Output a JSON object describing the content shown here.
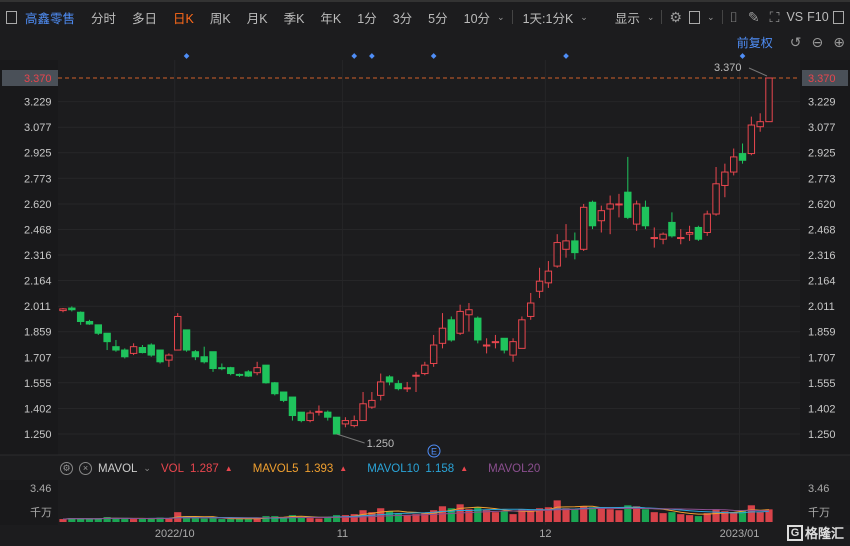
{
  "toolbar": {
    "stock_name": "高鑫零售",
    "periods": [
      "分时",
      "多日",
      "日K",
      "周K",
      "月K",
      "季K",
      "年K",
      "1分",
      "3分",
      "5分",
      "10分"
    ],
    "active_period": "日K",
    "multi_period": "1天:1分K",
    "display": "显示",
    "vs": "VS",
    "f10": "F10",
    "adjust": "前复权",
    "icons": [
      "sidebar-toggle-icon",
      "chevron-down-icon",
      "settings-icon",
      "layout-icon",
      "camera-icon",
      "pencil-icon",
      "fullscreen-icon",
      "undo-icon",
      "zoom-out-icon",
      "zoom-in-icon"
    ]
  },
  "chart_data": {
    "type": "candlestick",
    "y_ticks": [
      "3.370",
      "3.229",
      "3.077",
      "2.925",
      "2.773",
      "2.620",
      "2.468",
      "2.316",
      "2.164",
      "2.011",
      "1.859",
      "1.707",
      "1.555",
      "1.402",
      "1.250"
    ],
    "ylim": [
      1.25,
      3.37
    ],
    "x_labels": [
      {
        "label": "2022/10",
        "index": 13
      },
      {
        "label": "11",
        "index": 32
      },
      {
        "label": "12",
        "index": 55
      },
      {
        "label": "2023/01",
        "index": 77
      }
    ],
    "high_label": "3.370",
    "low_label": "1.250",
    "event_marker": "E",
    "event_diamond_indices": [
      14,
      33,
      35,
      42,
      57,
      77
    ],
    "ohlc": [
      [
        1.985,
        1.995,
        2.0,
        1.975
      ],
      [
        2.0,
        1.99,
        2.01,
        1.98
      ],
      [
        1.975,
        1.92,
        1.98,
        1.9
      ],
      [
        1.92,
        1.905,
        1.93,
        1.9
      ],
      [
        1.9,
        1.85,
        1.9,
        1.84
      ],
      [
        1.85,
        1.8,
        1.85,
        1.75
      ],
      [
        1.77,
        1.75,
        1.81,
        1.74
      ],
      [
        1.75,
        1.71,
        1.76,
        1.7
      ],
      [
        1.73,
        1.77,
        1.79,
        1.72
      ],
      [
        1.765,
        1.735,
        1.78,
        1.73
      ],
      [
        1.78,
        1.72,
        1.79,
        1.71
      ],
      [
        1.75,
        1.68,
        1.75,
        1.67
      ],
      [
        1.69,
        1.72,
        1.73,
        1.65
      ],
      [
        1.75,
        1.95,
        1.97,
        1.75
      ],
      [
        1.87,
        1.75,
        1.87,
        1.74
      ],
      [
        1.74,
        1.71,
        1.75,
        1.69
      ],
      [
        1.71,
        1.68,
        1.77,
        1.67
      ],
      [
        1.74,
        1.64,
        1.74,
        1.62
      ],
      [
        1.645,
        1.64,
        1.67,
        1.63
      ],
      [
        1.645,
        1.61,
        1.65,
        1.6
      ],
      [
        1.605,
        1.6,
        1.61,
        1.59
      ],
      [
        1.62,
        1.595,
        1.63,
        1.59
      ],
      [
        1.615,
        1.645,
        1.68,
        1.6
      ],
      [
        1.66,
        1.555,
        1.66,
        1.55
      ],
      [
        1.555,
        1.49,
        1.56,
        1.48
      ],
      [
        1.5,
        1.45,
        1.5,
        1.44
      ],
      [
        1.47,
        1.36,
        1.47,
        1.33
      ],
      [
        1.38,
        1.33,
        1.38,
        1.32
      ],
      [
        1.33,
        1.375,
        1.39,
        1.32
      ],
      [
        1.38,
        1.385,
        1.42,
        1.36
      ],
      [
        1.38,
        1.35,
        1.39,
        1.33
      ],
      [
        1.35,
        1.25,
        1.35,
        1.25
      ],
      [
        1.31,
        1.33,
        1.35,
        1.29
      ],
      [
        1.3,
        1.33,
        1.36,
        1.29
      ],
      [
        1.33,
        1.43,
        1.5,
        1.33
      ],
      [
        1.41,
        1.45,
        1.5,
        1.4
      ],
      [
        1.48,
        1.56,
        1.61,
        1.45
      ],
      [
        1.59,
        1.56,
        1.6,
        1.54
      ],
      [
        1.55,
        1.52,
        1.57,
        1.51
      ],
      [
        1.525,
        1.525,
        1.56,
        1.5
      ],
      [
        1.6,
        1.6,
        1.62,
        1.5
      ],
      [
        1.61,
        1.66,
        1.68,
        1.6
      ],
      [
        1.67,
        1.78,
        1.84,
        1.65
      ],
      [
        1.79,
        1.88,
        1.97,
        1.76
      ],
      [
        1.93,
        1.81,
        1.95,
        1.8
      ],
      [
        1.85,
        1.98,
        2.02,
        1.84
      ],
      [
        1.96,
        1.99,
        2.03,
        1.86
      ],
      [
        1.94,
        1.81,
        1.95,
        1.79
      ],
      [
        1.78,
        1.78,
        1.82,
        1.73
      ],
      [
        1.8,
        1.8,
        1.84,
        1.76
      ],
      [
        1.82,
        1.75,
        1.82,
        1.73
      ],
      [
        1.72,
        1.8,
        1.82,
        1.68
      ],
      [
        1.76,
        1.93,
        1.95,
        1.76
      ],
      [
        1.95,
        2.03,
        2.09,
        1.93
      ],
      [
        2.1,
        2.16,
        2.24,
        2.06
      ],
      [
        2.15,
        2.22,
        2.28,
        2.12
      ],
      [
        2.25,
        2.39,
        2.44,
        2.24
      ],
      [
        2.35,
        2.4,
        2.5,
        2.3
      ],
      [
        2.4,
        2.33,
        2.45,
        2.29
      ],
      [
        2.35,
        2.6,
        2.62,
        2.34
      ],
      [
        2.63,
        2.49,
        2.64,
        2.47
      ],
      [
        2.52,
        2.58,
        2.61,
        2.45
      ],
      [
        2.59,
        2.62,
        2.67,
        2.44
      ],
      [
        2.62,
        2.62,
        2.68,
        2.54
      ],
      [
        2.69,
        2.54,
        2.9,
        2.53
      ],
      [
        2.5,
        2.62,
        2.64,
        2.46
      ],
      [
        2.6,
        2.49,
        2.64,
        2.47
      ],
      [
        2.42,
        2.42,
        2.48,
        2.36
      ],
      [
        2.41,
        2.44,
        2.45,
        2.38
      ],
      [
        2.51,
        2.43,
        2.57,
        2.42
      ],
      [
        2.42,
        2.42,
        2.47,
        2.38
      ],
      [
        2.44,
        2.45,
        2.49,
        2.4
      ],
      [
        2.48,
        2.41,
        2.49,
        2.4
      ],
      [
        2.45,
        2.56,
        2.58,
        2.43
      ],
      [
        2.56,
        2.74,
        2.84,
        2.55
      ],
      [
        2.73,
        2.81,
        2.86,
        2.66
      ],
      [
        2.81,
        2.9,
        2.95,
        2.79
      ],
      [
        2.92,
        2.88,
        2.98,
        2.86
      ],
      [
        2.92,
        3.09,
        3.14,
        2.91
      ],
      [
        3.08,
        3.11,
        3.16,
        3.05
      ],
      [
        3.11,
        3.37,
        3.37,
        3.11
      ]
    ],
    "volume": {
      "unit": "千万",
      "ymax_label": "3.46",
      "ymax": 3.46,
      "values": [
        0.3,
        0.4,
        0.35,
        0.3,
        0.35,
        0.5,
        0.4,
        0.3,
        0.3,
        0.35,
        0.4,
        0.45,
        0.35,
        1.0,
        0.6,
        0.4,
        0.35,
        0.4,
        0.3,
        0.3,
        0.35,
        0.3,
        0.4,
        0.6,
        0.6,
        0.5,
        0.7,
        0.5,
        0.4,
        0.35,
        0.45,
        0.7,
        0.7,
        0.8,
        1.2,
        1.0,
        1.4,
        1.1,
        0.9,
        0.7,
        0.8,
        0.9,
        1.2,
        1.6,
        1.4,
        1.8,
        1.3,
        1.5,
        1.2,
        1.0,
        1.1,
        0.8,
        1.3,
        1.2,
        1.4,
        1.5,
        2.2,
        1.4,
        1.3,
        1.6,
        1.5,
        1.4,
        1.3,
        1.2,
        1.7,
        1.6,
        1.3,
        1.0,
        0.9,
        1.0,
        0.8,
        0.7,
        0.6,
        0.9,
        1.3,
        1.1,
        1.0,
        1.2,
        1.7,
        1.0,
        1.287
      ]
    }
  },
  "indicator": {
    "name": "MAVOL",
    "vol_label": "VOL",
    "vol_value": "1.287",
    "ma5_label": "MAVOL5",
    "ma5_value": "1.393",
    "ma10_label": "MAVOL10",
    "ma10_value": "1.158",
    "ma20_label": "MAVOL20"
  },
  "colors": {
    "up": "#e8464e",
    "down": "#1fc35c",
    "ma5": "#f0a030",
    "ma10": "#2aa4d8",
    "ma20": "#8b4f8f",
    "accent": "#4f8ef7",
    "active": "#ff6a1a"
  },
  "logo": "格隆汇"
}
